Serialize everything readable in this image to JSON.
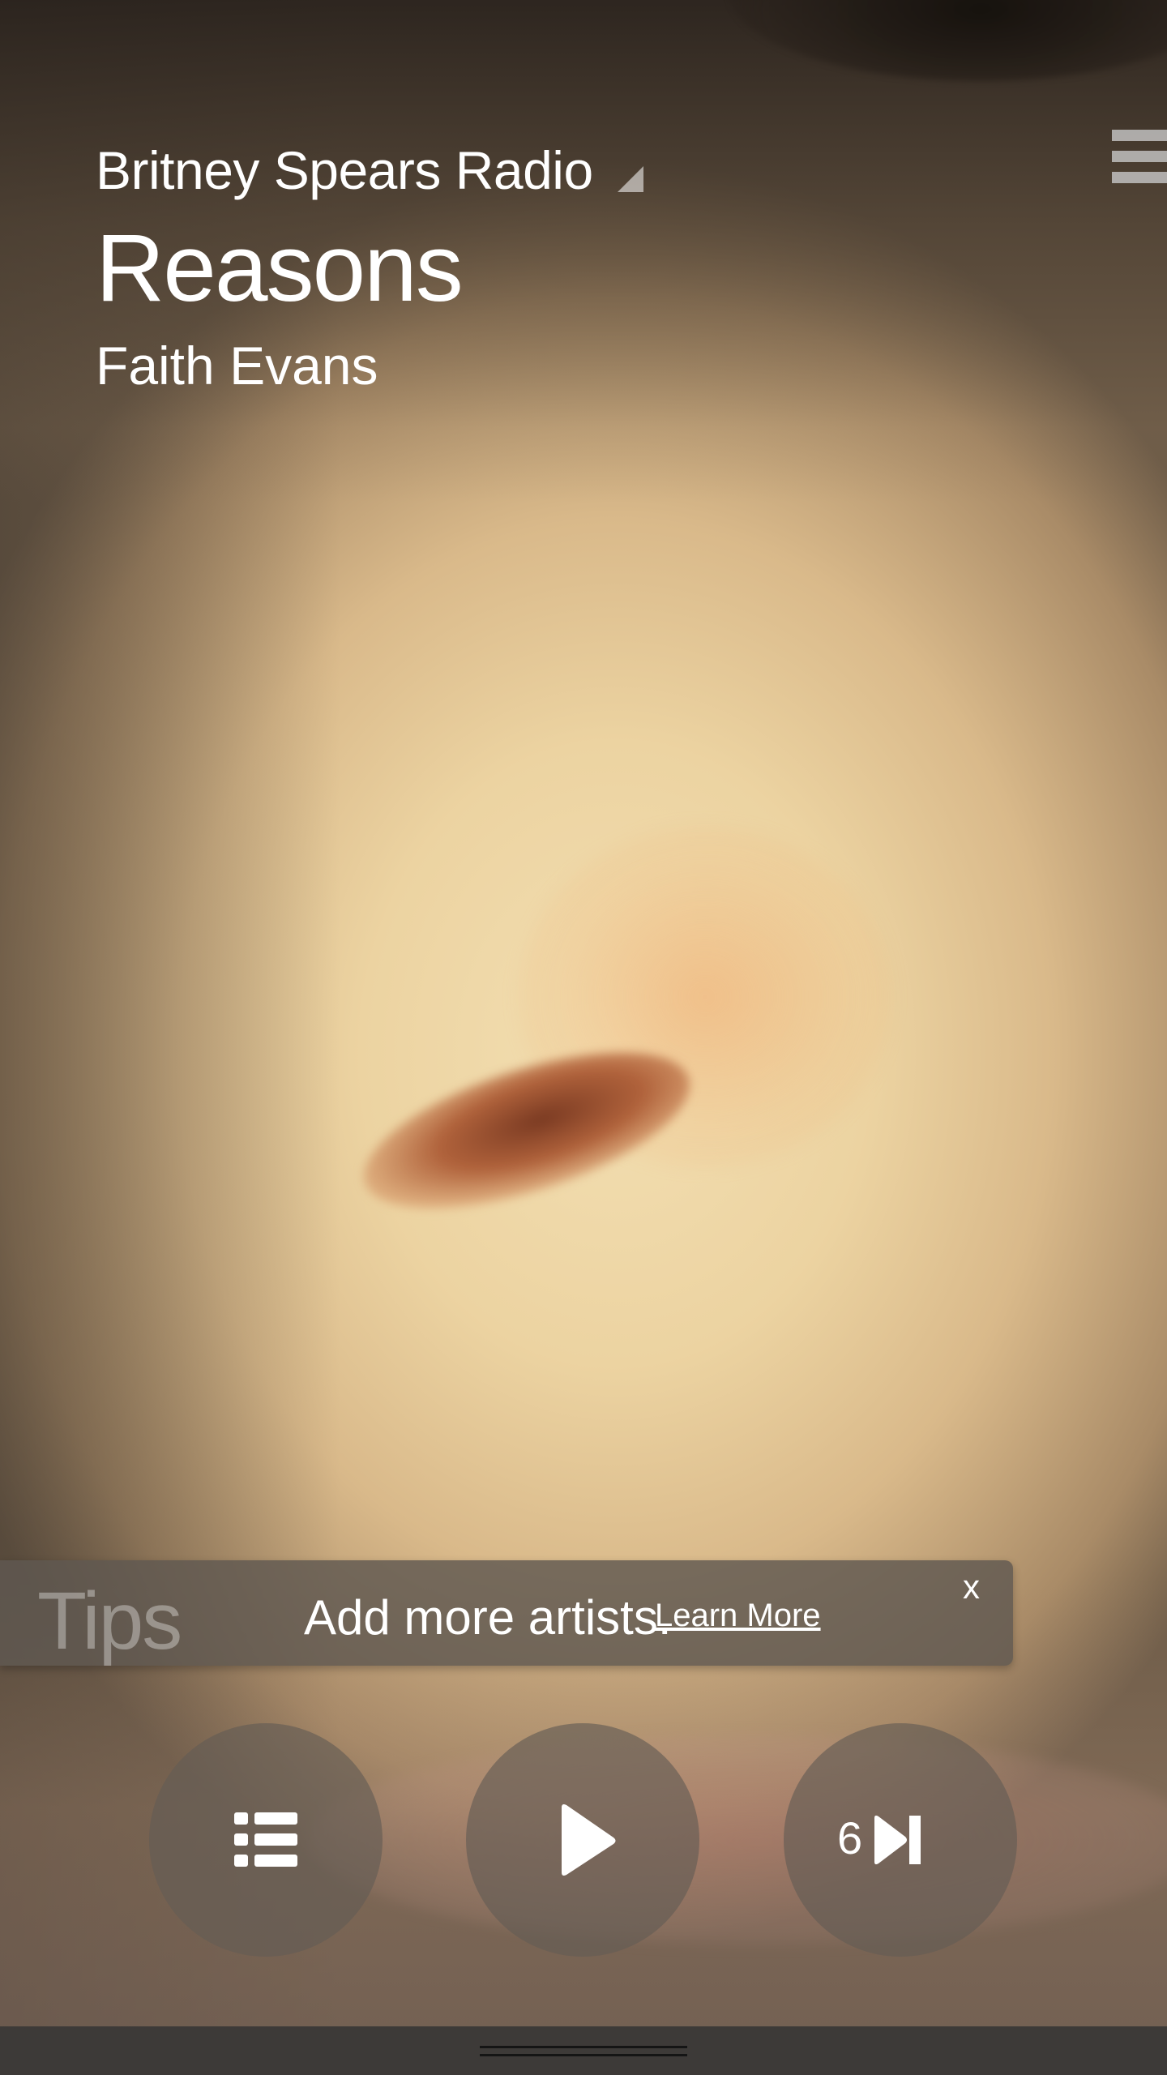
{
  "player": {
    "station": "Britney Spears Radio",
    "song_title": "Reasons",
    "artist": "Faith Evans"
  },
  "tips": {
    "label": "Tips",
    "message": "Add more artists.",
    "link": "Learn More",
    "close": "x"
  },
  "controls": {
    "skips_remaining": "6"
  },
  "icons": {
    "menu": "hamburger-menu-icon",
    "station_caret": "triangle-caret-icon",
    "queue": "list-icon",
    "play": "play-icon",
    "skip": "skip-next-icon"
  },
  "colors": {
    "panel": "#5f5850",
    "bottom_bar": "#3d3a38",
    "text": "#ffffff"
  }
}
